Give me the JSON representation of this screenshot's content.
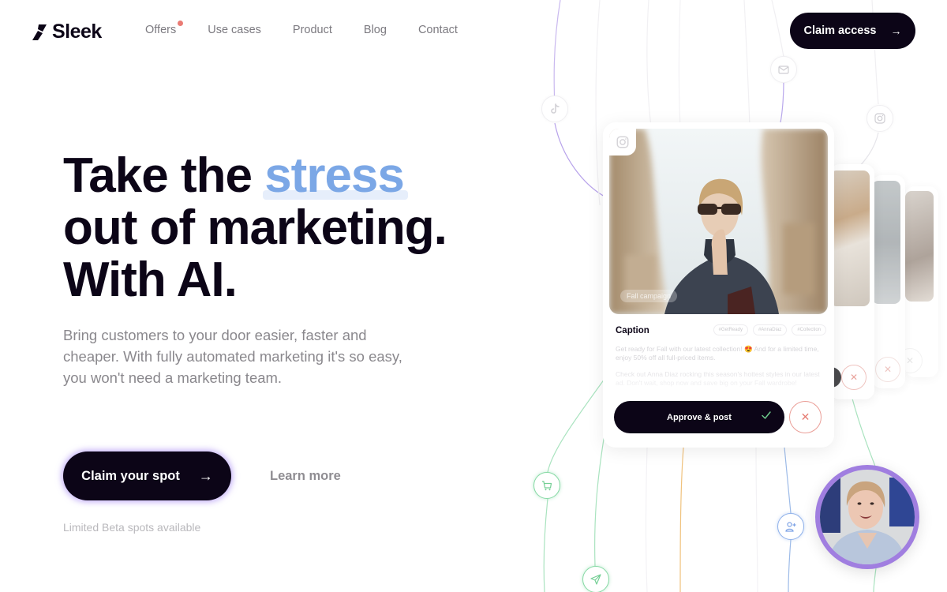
{
  "brand": {
    "name": "Sleek",
    "logo_icon": "sleek-logo-icon"
  },
  "nav": {
    "items": [
      {
        "label": "Offers",
        "badge": true,
        "badge_color": "#ea7b74"
      },
      {
        "label": "Use cases"
      },
      {
        "label": "Product"
      },
      {
        "label": "Blog"
      },
      {
        "label": "Contact"
      }
    ],
    "cta": {
      "label": "Claim access",
      "icon": "arrow-right-icon"
    }
  },
  "hero": {
    "title_prefix": "Take the",
    "title_highlight": "stress",
    "title_line2": "out of marketing.",
    "title_line3": "With AI.",
    "highlight_color": "#7ba7e6",
    "subtitle": "Bring customers to your door easier, faster and cheaper. With fully automated marketing it's so easy, you won't need a marketing team.",
    "primary_cta": {
      "label": "Claim your spot",
      "icon": "arrow-right-icon"
    },
    "secondary_cta": {
      "label": "Learn more"
    },
    "note": "Limited Beta spots available"
  },
  "channels": [
    {
      "name": "tiktok-icon"
    },
    {
      "name": "mail-icon"
    },
    {
      "name": "instagram-icon"
    },
    {
      "name": "cart-icon"
    },
    {
      "name": "send-icon"
    },
    {
      "name": "add-user-icon"
    }
  ],
  "post_card": {
    "platform_icon": "instagram-icon",
    "campaign_tag": "Fall campaign",
    "caption_label": "Caption",
    "hashtags": [
      "#GetReady",
      "#AnnaDiaz",
      "#Collection"
    ],
    "caption_paragraphs": [
      "Get ready for Fall with our latest collection! 😍 And for a limited time, enjoy 50% off all full-priced items.",
      "Check out Anna Diaz rocking this season's hottest styles in our latest ad. Don't wait, shop now and save big on your Fall wardrobe!"
    ],
    "approve_label": "Approve & post",
    "reject_label": "✕"
  },
  "colors": {
    "primary_dark": "#0c0517",
    "accent_purple": "#a07ee0",
    "reject_red": "#e67d74",
    "approve_check": "#6fcf8f"
  }
}
